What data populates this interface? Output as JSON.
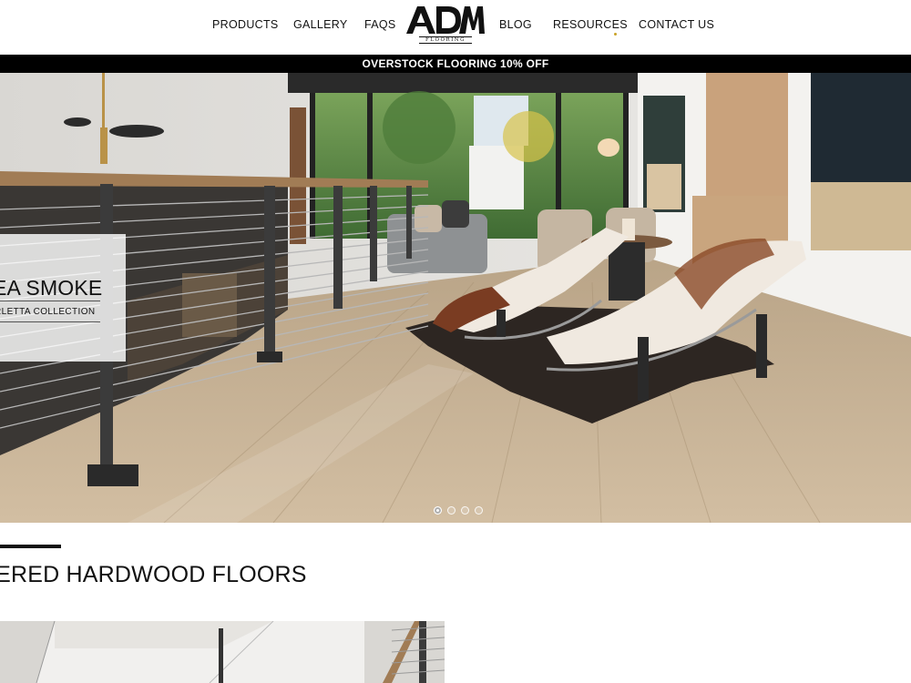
{
  "header": {
    "nav_left": [
      {
        "label": "PRODUCTS"
      },
      {
        "label": "GALLERY"
      },
      {
        "label": "FAQS"
      }
    ],
    "logo": {
      "mark": "ADM",
      "subtext": "FLOORING"
    },
    "nav_right": [
      {
        "label": "BLOG"
      },
      {
        "label": "RESOURCES"
      },
      {
        "label": "CONTACT US"
      }
    ]
  },
  "promo_banner": {
    "text": "OVERSTOCK FLOORING 10% OFF"
  },
  "hero": {
    "caption_title": "EA SMOKE",
    "caption_subtitle": "RLETTA COLLECTION",
    "slide_count": 4,
    "active_slide": 1
  },
  "section": {
    "title": "NEERED HARDWOOD FLOORS"
  },
  "colors": {
    "banner_bg": "#000000",
    "banner_text": "#ffffff",
    "accent_dot": "#c9a227",
    "floor": "#c7b196"
  },
  "icons": [
    "adm-logo-icon",
    "carousel-dot-icon"
  ]
}
